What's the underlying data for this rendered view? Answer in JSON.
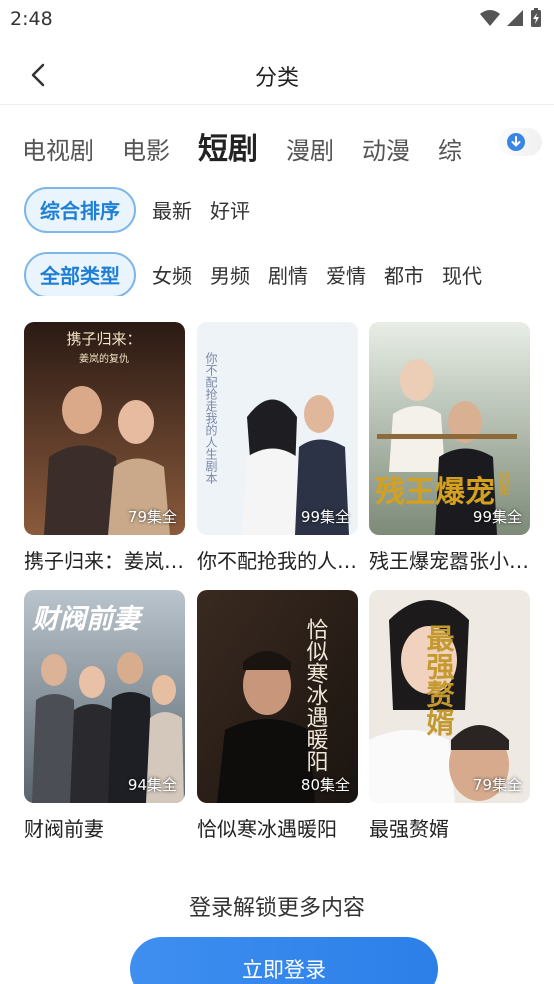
{
  "status_bar": {
    "time": "2:48"
  },
  "nav": {
    "title": "分类"
  },
  "tabs": [
    {
      "label": "电视剧"
    },
    {
      "label": "电影"
    },
    {
      "label": "短剧"
    },
    {
      "label": "漫剧"
    },
    {
      "label": "动漫"
    },
    {
      "label": "综"
    }
  ],
  "active_tab": "短剧",
  "sort_filters": [
    {
      "label": "综合排序"
    },
    {
      "label": "最新"
    },
    {
      "label": "好评"
    }
  ],
  "type_filters": [
    {
      "label": "全部类型"
    },
    {
      "label": "女频"
    },
    {
      "label": "男频"
    },
    {
      "label": "剧情"
    },
    {
      "label": "爱情"
    },
    {
      "label": "都市"
    },
    {
      "label": "现代"
    }
  ],
  "cards": [
    {
      "title": "携子归来：姜岚的复仇",
      "episodes": "79集全",
      "poster_text": "携子归来：",
      "poster_sub": "姜岚的复仇"
    },
    {
      "title": "你不配抢我的人生剧本",
      "episodes": "99集全",
      "poster_text": "你不配抢走我的人生剧本"
    },
    {
      "title": "残王爆宠嚣张小王妃",
      "episodes": "99集全",
      "poster_text": "残王爆宠",
      "poster_sub": "嚣张"
    },
    {
      "title": "财阀前妻",
      "episodes": "94集全",
      "poster_text": "财阀前妻"
    },
    {
      "title": "恰似寒冰遇暖阳",
      "episodes": "80集全",
      "poster_text": "恰似寒冰遇暖阳"
    },
    {
      "title": "最强赘婿",
      "episodes": "79集全",
      "poster_text": "最强赘婿"
    }
  ],
  "login": {
    "hint": "登录解锁更多内容",
    "button": "立即登录"
  },
  "colors": {
    "accent": "#2b7fe8",
    "chip_border": "#7db6e8",
    "chip_bg": "#eaf4fc"
  }
}
